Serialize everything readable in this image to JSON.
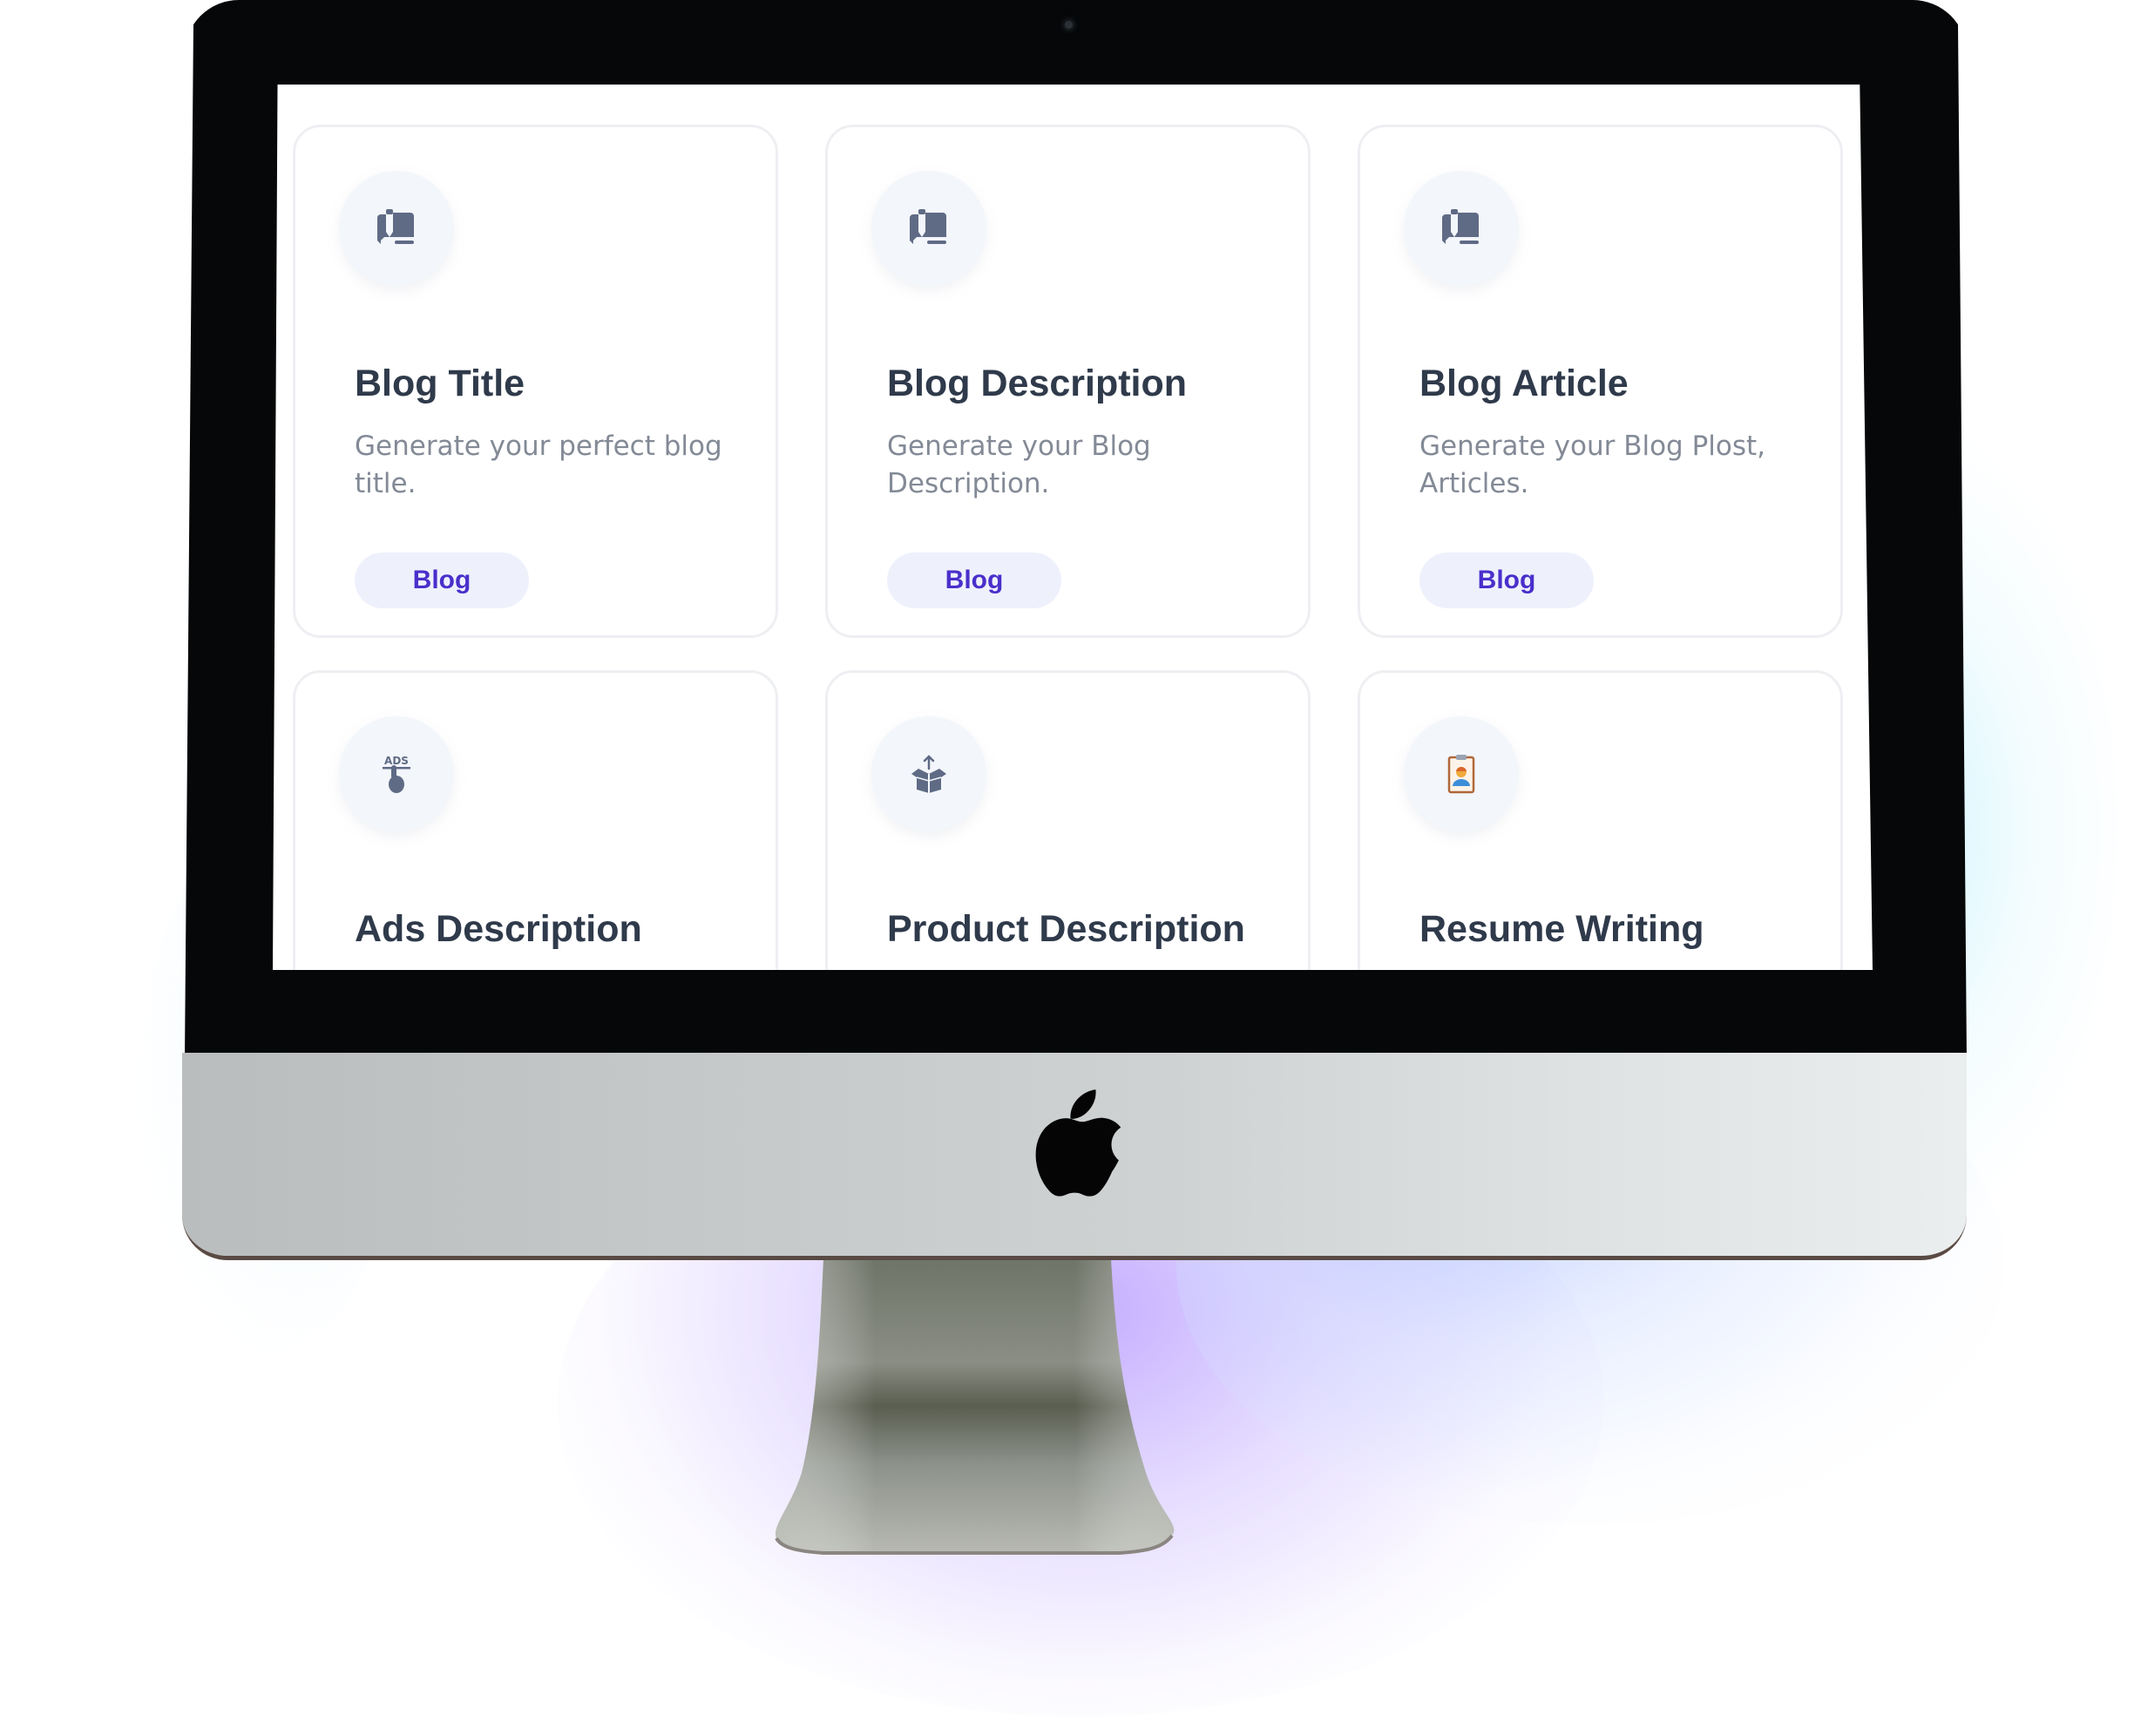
{
  "device": {
    "type": "desktop-monitor",
    "brand_logo": "apple-logo"
  },
  "screen": {
    "cards": [
      {
        "title": "Blog Title",
        "description": "Generate your perfect blog title.",
        "tag": "Blog",
        "icon": "blog-writing-icon"
      },
      {
        "title": "Blog Description",
        "description": "Generate your Blog Description.",
        "tag": "Blog",
        "icon": "blog-writing-icon"
      },
      {
        "title": "Blog Article",
        "description": "Generate your Blog Plost, Articles.",
        "tag": "Blog",
        "icon": "blog-writing-icon"
      },
      {
        "title": "Ads Description",
        "icon": "ads-click-icon"
      },
      {
        "title": "Product Description",
        "icon": "open-box-icon"
      },
      {
        "title": "Resume Writing",
        "icon": "resume-clipboard-icon"
      }
    ]
  },
  "colors": {
    "title": "#2f3a4b",
    "description": "#838a96",
    "tag_text": "#4a2fcb",
    "tag_bg": "#eef1fc",
    "icon": "#5f6b85",
    "icon_circle": "#f3f6fb",
    "glow_purple": "#b092ff",
    "glow_blue": "#aabeff",
    "glow_cyan": "#aaebfa"
  }
}
